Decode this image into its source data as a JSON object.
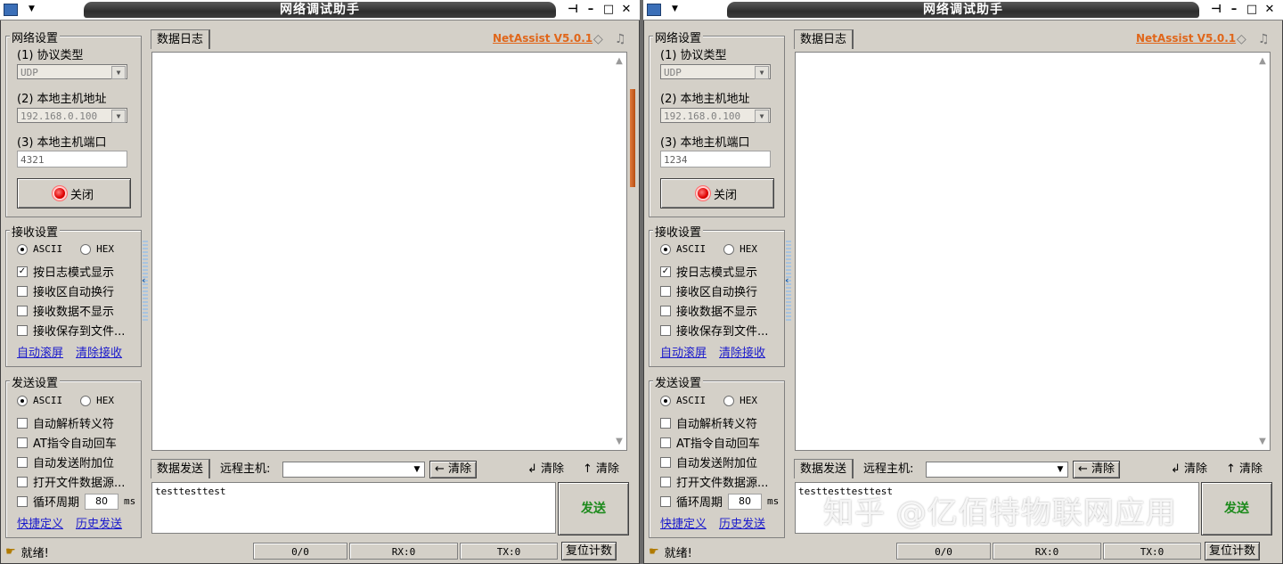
{
  "windows": [
    {
      "title": "网络调试助手",
      "brand": "NetAssist V5.0.1",
      "network": {
        "group_title": "网络设置",
        "protocol_label": "(1) 协议类型",
        "protocol_value": "UDP",
        "host_label": "(2) 本地主机地址",
        "host_value": "192.168.0.100",
        "port_label": "(3) 本地主机端口",
        "port_value": "4321",
        "close_button": "关闭"
      },
      "receive": {
        "group_title": "接收设置",
        "ascii": "ASCII",
        "hex": "HEX",
        "opt_log_mode": "按日志模式显示",
        "opt_auto_wrap": "接收区自动换行",
        "opt_hide_data": "接收数据不显示",
        "opt_save_file": "接收保存到文件...",
        "link_autoscroll": "自动滚屏",
        "link_clear": "清除接收"
      },
      "send": {
        "group_title": "发送设置",
        "ascii": "ASCII",
        "hex": "HEX",
        "opt_escape": "自动解析转义符",
        "opt_at": "AT指令自动回车",
        "opt_checksum": "自动发送附加位",
        "opt_file_source": "打开文件数据源...",
        "opt_cycle": "循环周期",
        "cycle_value": "80",
        "cycle_unit": "ms",
        "link_shortcut": "快捷定义",
        "link_history": "历史发送"
      },
      "main": {
        "log_tab": "数据日志",
        "send_tab": "数据发送",
        "remote_label": "远程主机:",
        "clear_btn": "← 清除",
        "clear2": "清除",
        "clear3": "清除",
        "send_text": "testtesttest",
        "send_button": "发送"
      },
      "status": {
        "ready": "就绪!",
        "count": "0/0",
        "rx": "RX:0",
        "tx": "TX:0",
        "reset": "复位计数"
      }
    },
    {
      "title": "网络调试助手",
      "brand": "NetAssist V5.0.1",
      "network": {
        "group_title": "网络设置",
        "protocol_label": "(1) 协议类型",
        "protocol_value": "UDP",
        "host_label": "(2) 本地主机地址",
        "host_value": "192.168.0.100",
        "port_label": "(3) 本地主机端口",
        "port_value": "1234",
        "close_button": "关闭"
      },
      "receive": {
        "group_title": "接收设置",
        "ascii": "ASCII",
        "hex": "HEX",
        "opt_log_mode": "按日志模式显示",
        "opt_auto_wrap": "接收区自动换行",
        "opt_hide_data": "接收数据不显示",
        "opt_save_file": "接收保存到文件...",
        "link_autoscroll": "自动滚屏",
        "link_clear": "清除接收"
      },
      "send": {
        "group_title": "发送设置",
        "ascii": "ASCII",
        "hex": "HEX",
        "opt_escape": "自动解析转义符",
        "opt_at": "AT指令自动回车",
        "opt_checksum": "自动发送附加位",
        "opt_file_source": "打开文件数据源...",
        "opt_cycle": "循环周期",
        "cycle_value": "80",
        "cycle_unit": "ms",
        "link_shortcut": "快捷定义",
        "link_history": "历史发送"
      },
      "main": {
        "log_tab": "数据日志",
        "send_tab": "数据发送",
        "remote_label": "远程主机:",
        "clear_btn": "← 清除",
        "clear2": "清除",
        "clear3": "清除",
        "send_text": "testtesttesttest",
        "send_button": "发送"
      },
      "status": {
        "ready": "就绪!",
        "count": "0/0",
        "rx": "RX:0",
        "tx": "TX:0",
        "reset": "复位计数"
      }
    }
  ],
  "watermark": "知乎 @亿佰特物联网应用",
  "colors": {
    "window_bg": "#d4d0c8",
    "brand": "#e0661a",
    "send_button_text": "#1b8a1b",
    "link": "#1a1acc"
  }
}
